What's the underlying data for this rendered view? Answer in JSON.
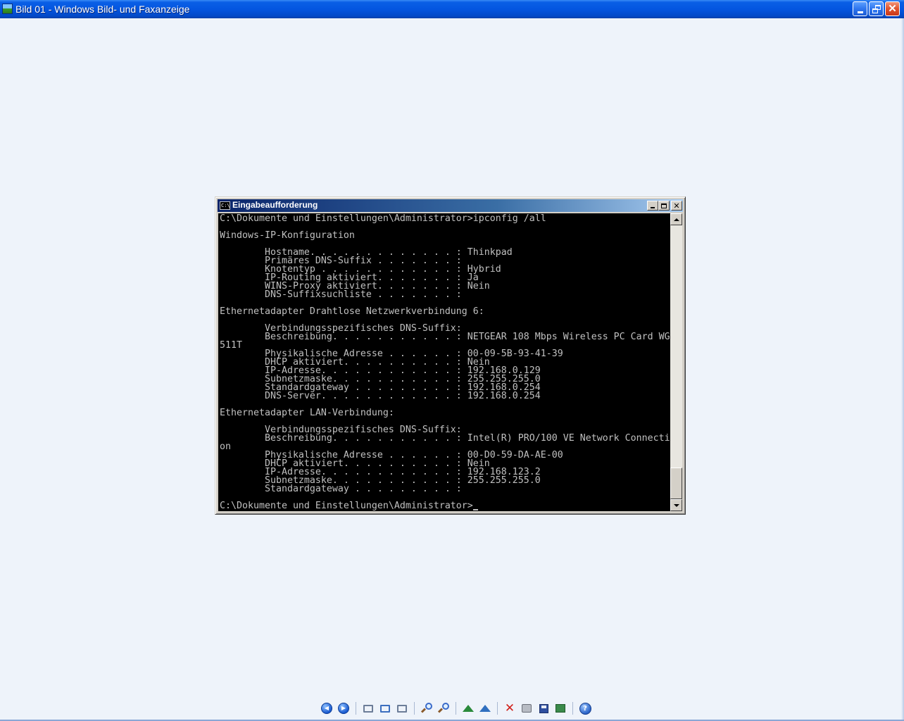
{
  "app": {
    "title": "Bild 01 - Windows Bild- und Faxanzeige"
  },
  "cmd": {
    "title": "Eingabeaufforderung",
    "icon_label": "C:\\",
    "lines": [
      "C:\\Dokumente und Einstellungen\\Administrator>ipconfig /all",
      "",
      "Windows-IP-Konfiguration",
      "",
      "        Hostname. . . . . . . . . . . . . : Thinkpad",
      "        Primäres DNS-Suffix . . . . . . . :",
      "        Knotentyp . . . . . . . . . . . . : Hybrid",
      "        IP-Routing aktiviert. . . . . . . : Ja",
      "        WINS-Proxy aktiviert. . . . . . . : Nein",
      "        DNS-Suffixsuchliste . . . . . . . :",
      "",
      "Ethernetadapter Drahtlose Netzwerkverbindung 6:",
      "",
      "        Verbindungsspezifisches DNS-Suffix:",
      "        Beschreibung. . . . . . . . . . . : NETGEAR 108 Mbps Wireless PC Card WG",
      "511T",
      "        Physikalische Adresse . . . . . . : 00-09-5B-93-41-39",
      "        DHCP aktiviert. . . . . . . . . . : Nein",
      "        IP-Adresse. . . . . . . . . . . . : 192.168.0.129",
      "        Subnetzmaske. . . . . . . . . . . : 255.255.255.0",
      "        Standardgateway . . . . . . . . . : 192.168.0.254",
      "        DNS-Server. . . . . . . . . . . . : 192.168.0.254",
      "",
      "Ethernetadapter LAN-Verbindung:",
      "",
      "        Verbindungsspezifisches DNS-Suffix:",
      "        Beschreibung. . . . . . . . . . . : Intel(R) PRO/100 VE Network Connecti",
      "on",
      "        Physikalische Adresse . . . . . . : 00-D0-59-DA-AE-00",
      "        DHCP aktiviert. . . . . . . . . . : Nein",
      "        IP-Adresse. . . . . . . . . . . . : 192.168.123.2",
      "        Subnetzmaske. . . . . . . . . . . : 255.255.255.0",
      "        Standardgateway . . . . . . . . . :",
      "",
      "C:\\Dokumente und Einstellungen\\Administrator>"
    ]
  },
  "toolbar": {
    "icons": [
      "previous-image-icon",
      "next-image-icon",
      "best-fit-icon",
      "actual-size-icon",
      "slideshow-icon",
      "zoom-in-icon",
      "zoom-out-icon",
      "rotate-clockwise-icon",
      "rotate-counterclockwise-icon",
      "delete-icon",
      "print-icon",
      "save-copy-icon",
      "edit-image-icon",
      "help-icon"
    ]
  },
  "colors": {
    "titlebar": "#0456e0",
    "viewer_background": "#eef3fa",
    "console_background": "#000000",
    "console_text": "#c0c0c0",
    "cmd_titlebar": "#0a246a"
  }
}
